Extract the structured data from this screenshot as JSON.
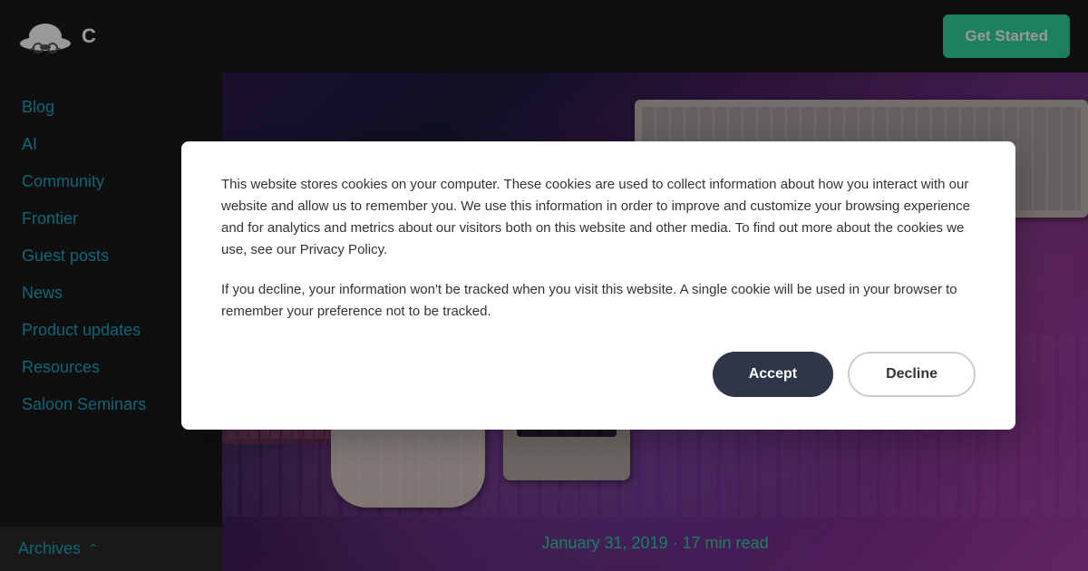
{
  "header": {
    "logo_alt": "Cowboy hat logo",
    "get_started_label": "Get Started"
  },
  "sidebar": {
    "items": [
      {
        "label": "Blog",
        "key": "blog"
      },
      {
        "label": "AI",
        "key": "ai"
      },
      {
        "label": "Community",
        "key": "community"
      },
      {
        "label": "Frontier",
        "key": "frontier"
      },
      {
        "label": "Guest posts",
        "key": "guest-posts"
      },
      {
        "label": "News",
        "key": "news"
      },
      {
        "label": "Product updates",
        "key": "product-updates"
      },
      {
        "label": "Resources",
        "key": "resources"
      },
      {
        "label": "Saloon Seminars",
        "key": "saloon-seminars"
      }
    ],
    "archives_label": "Archives"
  },
  "hero": {
    "date": "January 31, 2019 · 17 min read"
  },
  "cookie": {
    "text1": "This website stores cookies on your computer. These cookies are used to collect information about how you interact with our website and allow us to remember you. We use this information in order to improve and customize your browsing experience and for analytics and metrics about our visitors both on this website and other media. To find out more about the cookies we use, see our Privacy Policy.",
    "text2": "If you decline, your information won't be tracked when you visit this website. A single cookie will be used in your browser to remember your preference not to be tracked.",
    "accept_label": "Accept",
    "decline_label": "Decline"
  }
}
